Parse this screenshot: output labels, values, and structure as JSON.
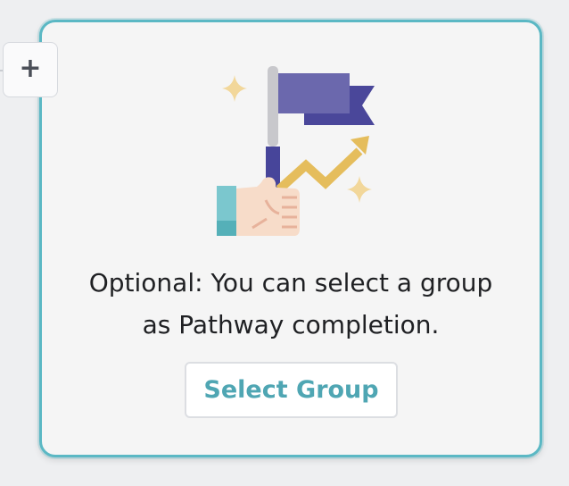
{
  "add_button": {
    "label": "+",
    "icon": "plus-icon"
  },
  "card": {
    "illustration_icon": "flag-growth-illustration",
    "message_line1": "Optional: You can select a group",
    "message_line2": "as Pathway completion.",
    "select_button_label": "Select Group"
  },
  "colors": {
    "accent": "#5bb8c4",
    "button_text": "#4fa6b3",
    "flag_purple": "#6b68ad",
    "flag_dark": "#4a479a",
    "arrow_gold": "#e5bd5c"
  }
}
